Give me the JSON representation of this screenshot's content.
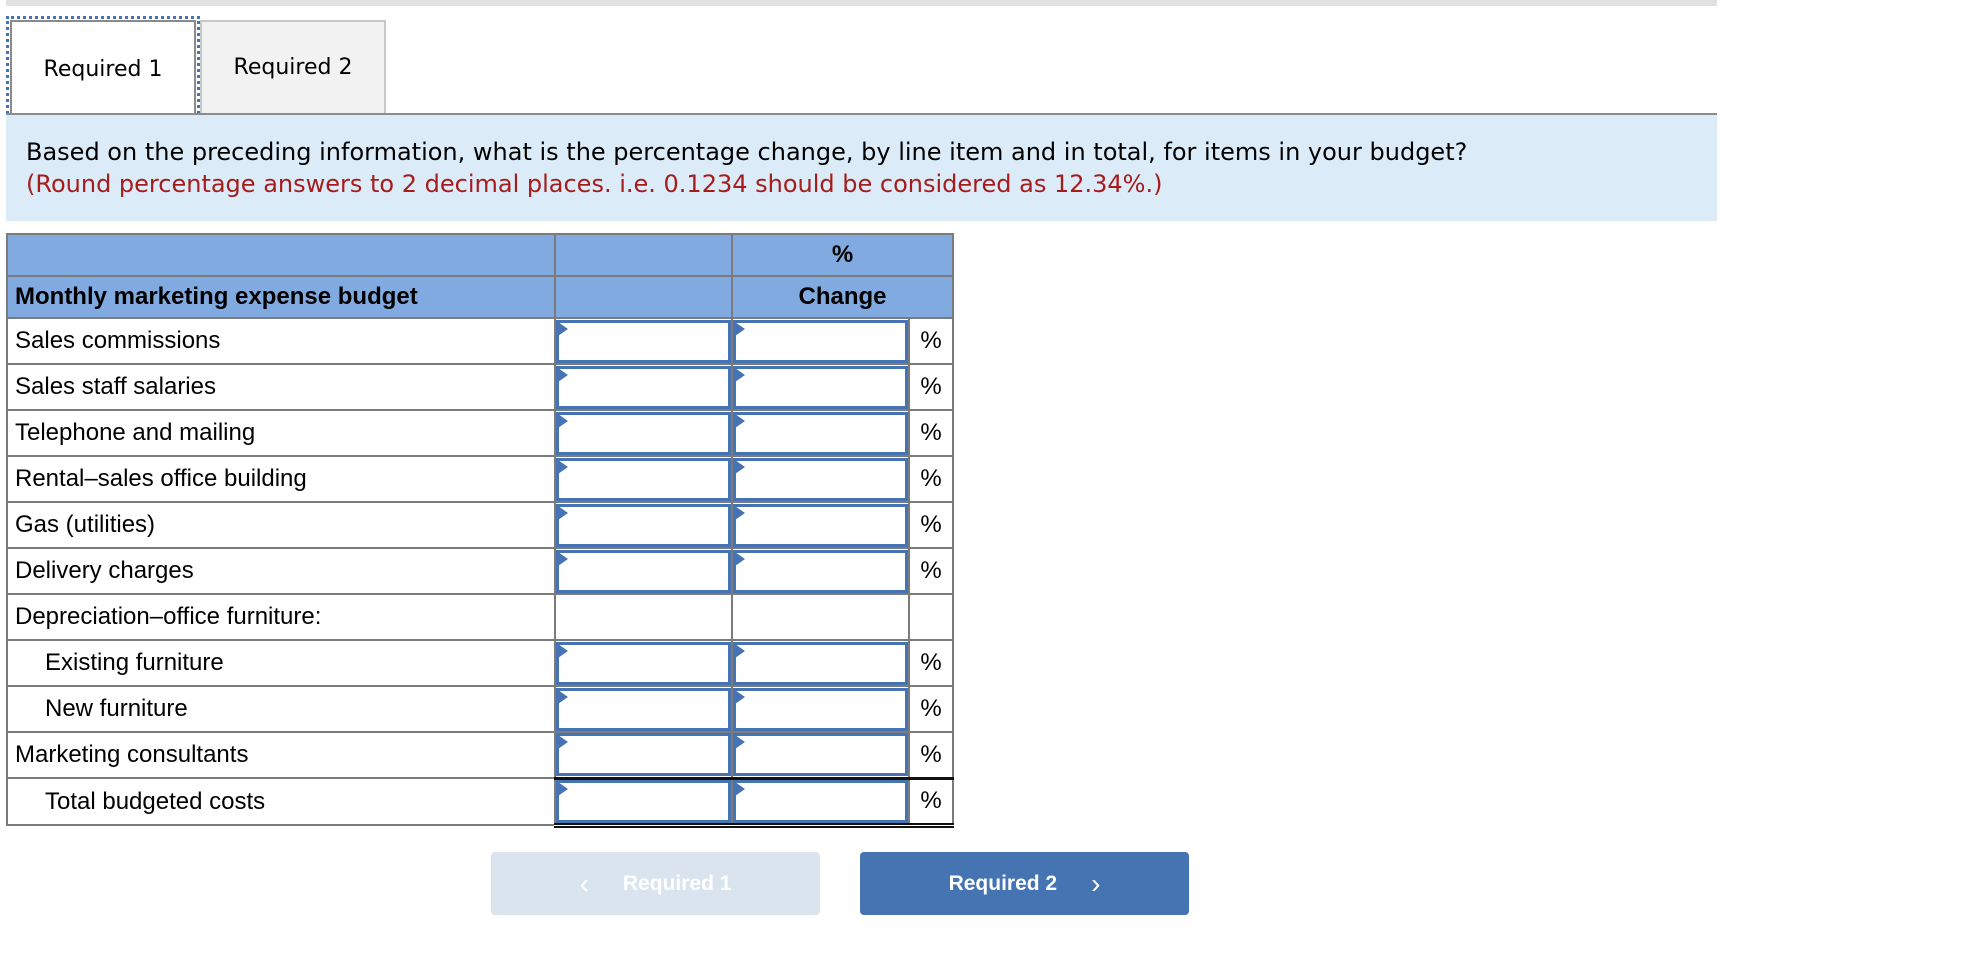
{
  "tabs": [
    {
      "label": "Required 1",
      "active": true
    },
    {
      "label": "Required 2",
      "active": false
    }
  ],
  "prompt": {
    "question": "Based on the preceding information, what is the percentage change, by line item and in total, for items in your budget?",
    "hint": "(Round percentage answers to 2 decimal places. i.e. 0.1234 should be considered as 12.34%.)"
  },
  "table": {
    "header_row1": {
      "col3": "%"
    },
    "header_row2": {
      "label": "Monthly marketing expense budget",
      "col3": "Change"
    },
    "percent_symbol": "%",
    "rows": [
      {
        "label": "Sales commissions",
        "value1": "",
        "value2": ""
      },
      {
        "label": "Sales staff salaries",
        "value1": "",
        "value2": ""
      },
      {
        "label": "Telephone and mailing",
        "value1": "",
        "value2": ""
      },
      {
        "label": "Rental–sales office building",
        "value1": "",
        "value2": ""
      },
      {
        "label": "Gas (utilities)",
        "value1": "",
        "value2": ""
      },
      {
        "label": "Delivery charges",
        "value1": "",
        "value2": ""
      },
      {
        "label": "Depreciation–office furniture:"
      },
      {
        "label": "Existing furniture",
        "value1": "",
        "value2": ""
      },
      {
        "label": "New furniture",
        "value1": "",
        "value2": ""
      },
      {
        "label": "Marketing consultants",
        "value1": "",
        "value2": ""
      },
      {
        "label": "Total budgeted costs",
        "value1": "",
        "value2": ""
      }
    ]
  },
  "nav": {
    "prev_label": "Required 1",
    "next_label": "Required 2",
    "prev_icon": "chevron-left-icon",
    "next_icon": "chevron-right-icon"
  },
  "colors": {
    "header_blue": "#81abe0",
    "input_border": "#4573b3",
    "prompt_bg": "#dcebf8",
    "hint_red": "#a61c1c",
    "next_button": "#4574b3",
    "prev_button_disabled": "#dae4ef"
  }
}
